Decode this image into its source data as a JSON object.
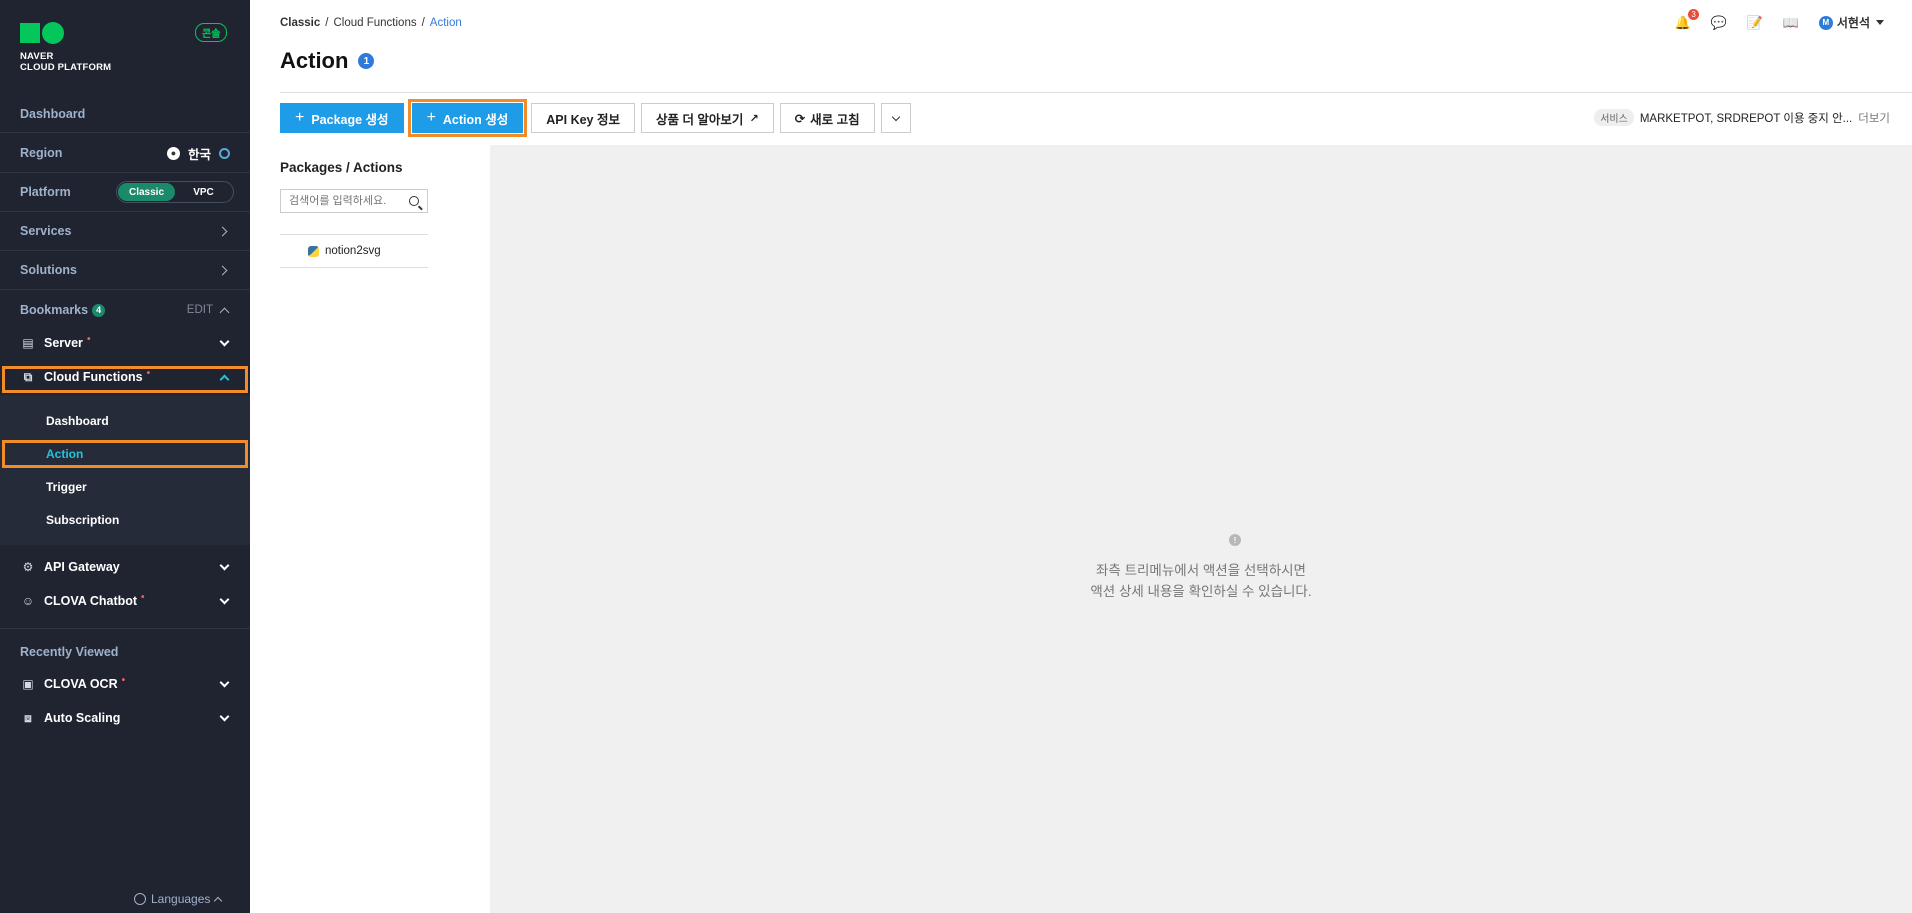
{
  "sidebar": {
    "logo": {
      "line1": "NAVER",
      "line2": "CLOUD PLATFORM"
    },
    "badge": "콘솔",
    "dashboard": "Dashboard",
    "region": {
      "label": "Region",
      "value": "한국"
    },
    "platform": {
      "label": "Platform",
      "options": [
        "Classic",
        "VPC"
      ],
      "selected": "Classic"
    },
    "services": "Services",
    "solutions": "Solutions",
    "bookmarks": {
      "label": "Bookmarks",
      "count": "4",
      "edit": "EDIT"
    },
    "bookmark_items": [
      {
        "label": "Server",
        "new_dot": "•",
        "icon": "server-icon"
      },
      {
        "label": "Cloud Functions",
        "new_dot": "•",
        "icon": "cloud-functions-icon",
        "expanded": true,
        "children": [
          "Dashboard",
          "Action",
          "Trigger",
          "Subscription"
        ],
        "active_child": "Action"
      },
      {
        "label": "API Gateway",
        "new_dot": "",
        "icon": "api-gateway-icon"
      },
      {
        "label": "CLOVA Chatbot",
        "new_dot": "•",
        "icon": "chatbot-icon"
      }
    ],
    "recently_viewed": {
      "label": "Recently Viewed",
      "items": [
        {
          "label": "CLOVA OCR",
          "new_dot": "•",
          "icon": "ocr-icon"
        },
        {
          "label": "Auto Scaling",
          "new_dot": "",
          "icon": "auto-scaling-icon"
        }
      ]
    },
    "languages": "Languages"
  },
  "header": {
    "breadcrumb": [
      "Classic",
      "Cloud Functions",
      "Action"
    ],
    "title": "Action",
    "title_badge": "1",
    "notifications_count": "3",
    "user_initial": "M",
    "user_name": "서현석"
  },
  "toolbar": {
    "package_create": "Package 생성",
    "action_create": "Action 생성",
    "api_key": "API Key 정보",
    "learn_more": "상품 더 알아보기",
    "refresh": "새로 고침"
  },
  "notice": {
    "tag": "서비스",
    "text": "MARKETPOT, SRDREPOT 이용 중지 안...",
    "more": "더보기"
  },
  "tree_panel": {
    "title": "Packages / Actions",
    "search_placeholder": "검색어를 입력하세요.",
    "items": [
      "notion2svg"
    ]
  },
  "detail": {
    "empty_line1": "좌측 트리메뉴에서 액션을 선택하시면",
    "empty_line2": "액션 상세 내용을 확인하실 수 있습니다."
  },
  "colors": {
    "accent": "#1e9ce8",
    "highlight": "#f28c28",
    "active_menu": "#21c4d8",
    "sidebar_bg": "#1f2430"
  }
}
